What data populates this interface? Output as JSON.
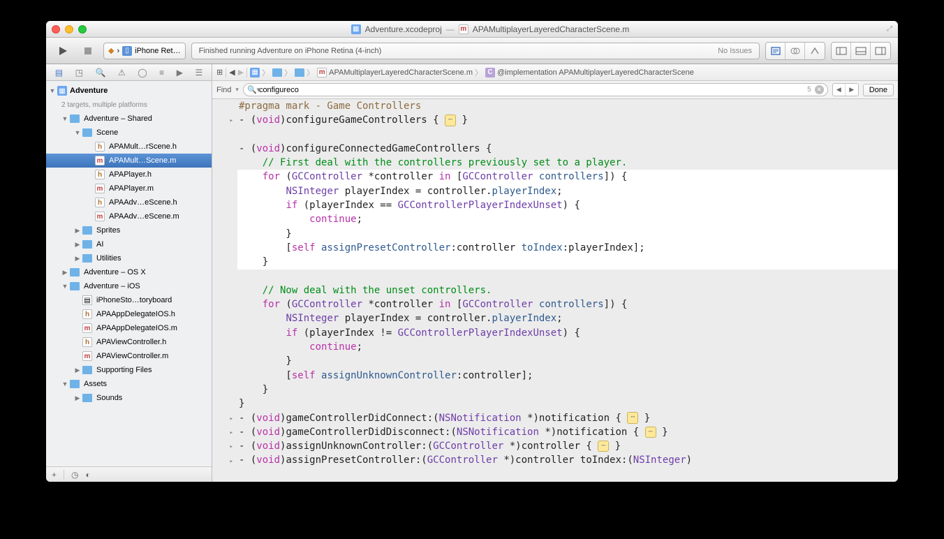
{
  "title": {
    "project": "Adventure.xcodeproj",
    "sep": "—",
    "file": "APAMultiplayerLayeredCharacterScene.m"
  },
  "toolbar": {
    "scheme_app": "A",
    "scheme_dest": "iPhone Ret…",
    "status_msg": "Finished running Adventure on iPhone Retina (4-inch)",
    "status_issues": "No Issues"
  },
  "jump": {
    "file": "APAMultiplayerLayeredCharacterScene.m",
    "symbol": "@implementation APAMultiplayerLayeredCharacterScene"
  },
  "find": {
    "label": "Find",
    "query": "configureco",
    "count": "5",
    "done": "Done"
  },
  "nav": {
    "project": "Adventure",
    "subtitle": "2 targets, multiple platforms",
    "items": [
      {
        "d": 1,
        "open": true,
        "icon": "folder",
        "label": "Adventure – Shared"
      },
      {
        "d": 2,
        "open": true,
        "icon": "folder",
        "label": "Scene"
      },
      {
        "d": 3,
        "icon": "h",
        "label": "APAMult…rScene.h"
      },
      {
        "d": 3,
        "icon": "m",
        "label": "APAMult…Scene.m",
        "sel": true
      },
      {
        "d": 3,
        "icon": "h",
        "label": "APAPlayer.h"
      },
      {
        "d": 3,
        "icon": "m",
        "label": "APAPlayer.m"
      },
      {
        "d": 3,
        "icon": "h",
        "label": "APAAdv…eScene.h"
      },
      {
        "d": 3,
        "icon": "m",
        "label": "APAAdv…eScene.m"
      },
      {
        "d": 2,
        "closed": true,
        "icon": "folder",
        "label": "Sprites"
      },
      {
        "d": 2,
        "closed": true,
        "icon": "folder",
        "label": "AI"
      },
      {
        "d": 2,
        "closed": true,
        "icon": "folder",
        "label": "Utilities"
      },
      {
        "d": 1,
        "closed": true,
        "icon": "folder",
        "label": "Adventure – OS X"
      },
      {
        "d": 1,
        "open": true,
        "icon": "folder",
        "label": "Adventure – iOS"
      },
      {
        "d": 2,
        "icon": "sb",
        "label": "iPhoneSto…toryboard"
      },
      {
        "d": 2,
        "icon": "h",
        "label": "APAAppDelegateIOS.h"
      },
      {
        "d": 2,
        "icon": "m",
        "label": "APAAppDelegateIOS.m"
      },
      {
        "d": 2,
        "icon": "h",
        "label": "APAViewController.h"
      },
      {
        "d": 2,
        "icon": "m",
        "label": "APAViewController.m"
      },
      {
        "d": 2,
        "closed": true,
        "icon": "folder",
        "label": "Supporting Files"
      },
      {
        "d": 1,
        "open": true,
        "icon": "folder",
        "label": "Assets"
      },
      {
        "d": 2,
        "closed": true,
        "icon": "folder",
        "label": "Sounds"
      }
    ]
  },
  "code": {
    "lines": [
      {
        "fold": "",
        "html": "<span class='prag'>#pragma mark - Game Controllers</span>"
      },
      {
        "fold": "▸",
        "html": "- (<span class='kw'>void</span>)configureGameControllers { <span class='pill'>⋯</span> }"
      },
      {
        "fold": "",
        "html": ""
      },
      {
        "fold": "",
        "html": "- (<span class='kw'>void</span>)configureConnectedGameControllers {"
      },
      {
        "fold": "",
        "html": "    <span class='cm'>// First deal with the controllers previously set to a player.</span>"
      },
      {
        "fold": "",
        "hl": true,
        "html": "    <span class='kw'>for</span> (<span class='type'>GCController</span> *controller <span class='kw'>in</span> [<span class='type'>GCController</span> <span class='fn'>controllers</span>]) {"
      },
      {
        "fold": "",
        "hl": true,
        "html": "        <span class='type'>NSInteger</span> playerIndex = controller.<span class='fn'>playerIndex</span>;"
      },
      {
        "fold": "",
        "hl": true,
        "html": "        <span class='kw'>if</span> (playerIndex == <span class='type'>GCControllerPlayerIndexUnset</span>) {"
      },
      {
        "fold": "",
        "hl": true,
        "html": "            <span class='kw'>continue</span>;"
      },
      {
        "fold": "",
        "hl": true,
        "html": "        }"
      },
      {
        "fold": "",
        "hl": true,
        "html": "        [<span class='kw'>self</span> <span class='fn'>assignPresetController</span>:controller <span class='fn'>toIndex</span>:playerIndex];"
      },
      {
        "fold": "",
        "hl": true,
        "html": "    }"
      },
      {
        "fold": "",
        "html": ""
      },
      {
        "fold": "",
        "html": "    <span class='cm'>// Now deal with the unset controllers.</span>"
      },
      {
        "fold": "",
        "html": "    <span class='kw'>for</span> (<span class='type'>GCController</span> *controller <span class='kw'>in</span> [<span class='type'>GCController</span> <span class='fn'>controllers</span>]) {"
      },
      {
        "fold": "",
        "html": "        <span class='type'>NSInteger</span> playerIndex = controller.<span class='fn'>playerIndex</span>;"
      },
      {
        "fold": "",
        "html": "        <span class='kw'>if</span> (playerIndex != <span class='type'>GCControllerPlayerIndexUnset</span>) {"
      },
      {
        "fold": "",
        "html": "            <span class='kw'>continue</span>;"
      },
      {
        "fold": "",
        "html": "        }"
      },
      {
        "fold": "",
        "html": "        [<span class='kw'>self</span> <span class='fn'>assignUnknownController</span>:controller];"
      },
      {
        "fold": "",
        "html": "    }"
      },
      {
        "fold": "",
        "html": "}"
      },
      {
        "fold": "▸",
        "html": "- (<span class='kw'>void</span>)gameControllerDidConnect:(<span class='type'>NSNotification</span> *)notification { <span class='pill'>⋯</span> }"
      },
      {
        "fold": "▸",
        "html": "- (<span class='kw'>void</span>)gameControllerDidDisconnect:(<span class='type'>NSNotification</span> *)notification { <span class='pill'>⋯</span> }"
      },
      {
        "fold": "▸",
        "html": "- (<span class='kw'>void</span>)assignUnknownController:(<span class='type'>GCController</span> *)controller { <span class='pill'>⋯</span> }"
      },
      {
        "fold": "▸",
        "html": "- (<span class='kw'>void</span>)assignPresetController:(<span class='type'>GCController</span> *)controller toIndex:(<span class='type'>NSInteger</span>)"
      }
    ]
  }
}
